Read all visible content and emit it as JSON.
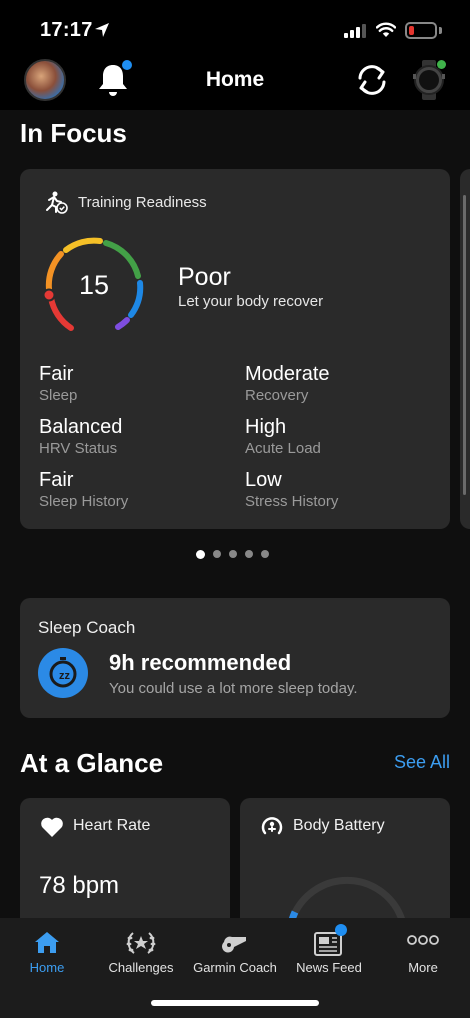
{
  "status_bar": {
    "time": "17:17"
  },
  "header": {
    "title": "Home"
  },
  "in_focus": {
    "title": "In Focus",
    "training_readiness": {
      "label": "Training Readiness",
      "score": "15",
      "status": "Poor",
      "description": "Let your body recover",
      "metrics": [
        {
          "value": "Fair",
          "label": "Sleep"
        },
        {
          "value": "Moderate",
          "label": "Recovery"
        },
        {
          "value": "Balanced",
          "label": "HRV Status"
        },
        {
          "value": "High",
          "label": "Acute Load"
        },
        {
          "value": "Fair",
          "label": "Sleep History"
        },
        {
          "value": "Low",
          "label": "Stress History"
        }
      ]
    },
    "carousel": {
      "pages": 5,
      "active_index": 0
    }
  },
  "sleep_coach": {
    "title": "Sleep Coach",
    "value": "9h  recommended",
    "description": "You could use a lot more sleep today."
  },
  "at_a_glance": {
    "title": "At a Glance",
    "see_all": "See All",
    "cards": [
      {
        "label": "Heart Rate",
        "value": "78 bpm",
        "icon": "heart-icon"
      },
      {
        "label": "Body Battery",
        "icon": "body-battery-icon"
      }
    ]
  },
  "tab_bar": {
    "items": [
      {
        "label": "Home",
        "icon": "home-icon",
        "active": true
      },
      {
        "label": "Challenges",
        "icon": "laurel-icon",
        "active": false
      },
      {
        "label": "Garmin Coach",
        "icon": "whistle-icon",
        "active": false
      },
      {
        "label": "News Feed",
        "icon": "news-icon",
        "active": false
      },
      {
        "label": "More",
        "icon": "more-icon",
        "active": false
      }
    ]
  },
  "colors": {
    "accent": "#3c9df0",
    "card": "#2a2a2a",
    "background": "#0f0f0f"
  }
}
